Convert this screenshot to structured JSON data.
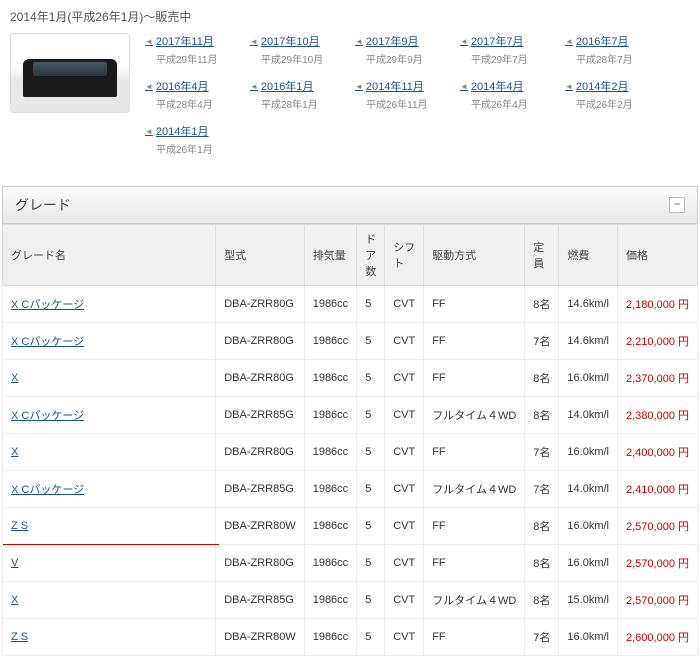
{
  "header": {
    "period_text": "2014年1月(平成26年1月)～販売中"
  },
  "year_links": [
    {
      "link": "2017年11月",
      "sub": "平成29年11月"
    },
    {
      "link": "2017年10月",
      "sub": "平成29年10月"
    },
    {
      "link": "2017年9月",
      "sub": "平成29年9月"
    },
    {
      "link": "2017年7月",
      "sub": "平成29年7月"
    },
    {
      "link": "2016年7月",
      "sub": "平成28年7月"
    },
    {
      "link": "2016年4月",
      "sub": "平成28年4月"
    },
    {
      "link": "2016年1月",
      "sub": "平成28年1月"
    },
    {
      "link": "2014年11月",
      "sub": "平成26年11月"
    },
    {
      "link": "2014年4月",
      "sub": "平成26年4月"
    },
    {
      "link": "2014年2月",
      "sub": "平成26年2月"
    },
    {
      "link": "2014年1月",
      "sub": "平成26年1月"
    }
  ],
  "section_title": "グレード",
  "collapse_label": "−",
  "columns": {
    "grade": "グレード名",
    "model": "型式",
    "disp": "排気量",
    "doors": "ドア数",
    "shift": "シフト",
    "drive": "駆動方式",
    "capacity": "定員",
    "fuel": "燃費",
    "price": "価格"
  },
  "rows": [
    {
      "grade": "X Cパッケージ",
      "model": "DBA-ZRR80G",
      "disp": "1986cc",
      "doors": "5",
      "shift": "CVT",
      "drive": "FF",
      "capacity": "8名",
      "fuel": "14.6km/l",
      "price": "2,180,000 円"
    },
    {
      "grade": "X Cパッケージ",
      "model": "DBA-ZRR80G",
      "disp": "1986cc",
      "doors": "5",
      "shift": "CVT",
      "drive": "FF",
      "capacity": "7名",
      "fuel": "14.6km/l",
      "price": "2,210,000 円"
    },
    {
      "grade": "X",
      "model": "DBA-ZRR80G",
      "disp": "1986cc",
      "doors": "5",
      "shift": "CVT",
      "drive": "FF",
      "capacity": "8名",
      "fuel": "16.0km/l",
      "price": "2,370,000 円"
    },
    {
      "grade": "X Cパッケージ",
      "model": "DBA-ZRR85G",
      "disp": "1986cc",
      "doors": "5",
      "shift": "CVT",
      "drive": "フルタイム４WD",
      "capacity": "8名",
      "fuel": "14.0km/l",
      "price": "2,380,000 円"
    },
    {
      "grade": "X",
      "model": "DBA-ZRR80G",
      "disp": "1986cc",
      "doors": "5",
      "shift": "CVT",
      "drive": "FF",
      "capacity": "7名",
      "fuel": "16.0km/l",
      "price": "2,400,000 円"
    },
    {
      "grade": "X Cパッケージ",
      "model": "DBA-ZRR85G",
      "disp": "1986cc",
      "doors": "5",
      "shift": "CVT",
      "drive": "フルタイム４WD",
      "capacity": "7名",
      "fuel": "14.0km/l",
      "price": "2,410,000 円"
    },
    {
      "grade": "Z S",
      "model": "DBA-ZRR80W",
      "disp": "1986cc",
      "doors": "5",
      "shift": "CVT",
      "drive": "FF",
      "capacity": "8名",
      "fuel": "16.0km/l",
      "price": "2,570,000 円",
      "highlight": true
    },
    {
      "grade": "V",
      "model": "DBA-ZRR80G",
      "disp": "1986cc",
      "doors": "5",
      "shift": "CVT",
      "drive": "FF",
      "capacity": "8名",
      "fuel": "16.0km/l",
      "price": "2,570,000 円"
    },
    {
      "grade": "X",
      "model": "DBA-ZRR85G",
      "disp": "1986cc",
      "doors": "5",
      "shift": "CVT",
      "drive": "フルタイム４WD",
      "capacity": "8名",
      "fuel": "15.0km/l",
      "price": "2,570,000 円"
    },
    {
      "grade": "Z S",
      "model": "DBA-ZRR80W",
      "disp": "1986cc",
      "doors": "5",
      "shift": "CVT",
      "drive": "FF",
      "capacity": "7名",
      "fuel": "16.0km/l",
      "price": "2,600,000 円"
    }
  ]
}
